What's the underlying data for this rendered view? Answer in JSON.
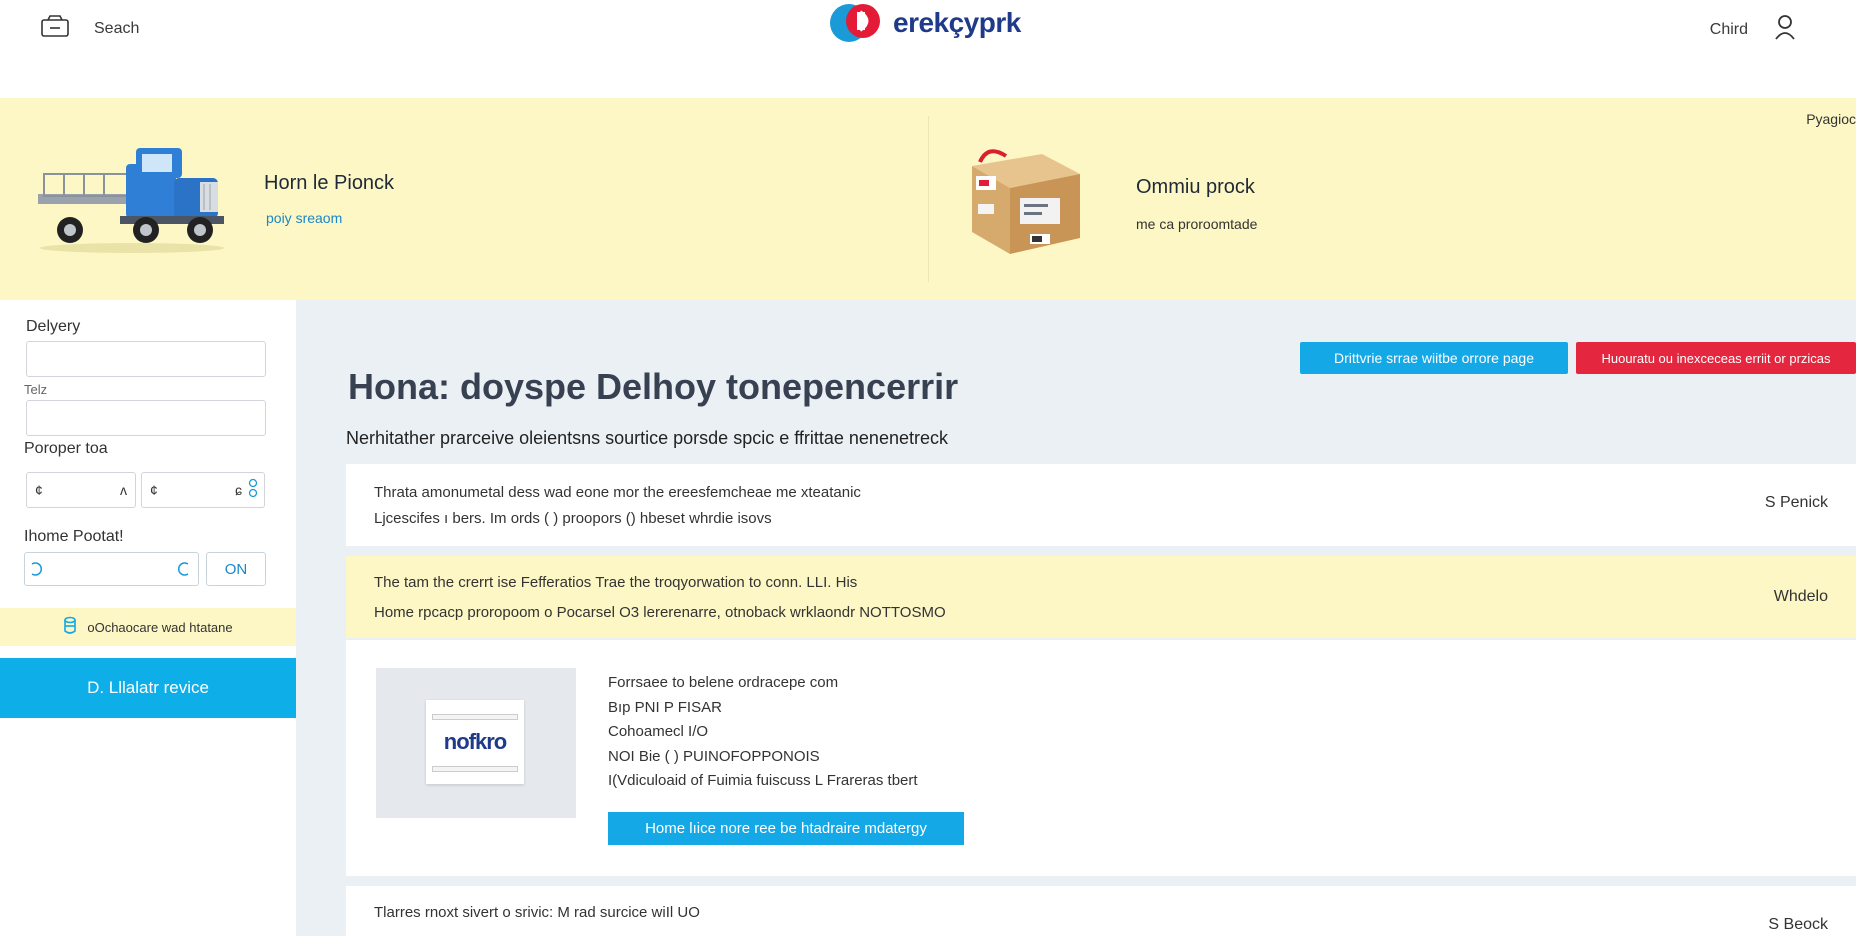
{
  "header": {
    "search_label": "Seach",
    "logo_text": "erekçyprk",
    "child_label": "Chird"
  },
  "hero": {
    "corner_label": "Pyagioc",
    "left": {
      "title": "Horn le Pionck",
      "link": "poiy sreaom"
    },
    "right": {
      "title": "Ommiu prock",
      "subtitle": "me ca proroomtade"
    }
  },
  "sidebar": {
    "delivery_label": "Delyery",
    "delivery_value": "",
    "tel_label": "Telz",
    "tel_value": "",
    "property_label": "Poroper toa",
    "property_from": "¢",
    "property_from_suffix": "ʌ",
    "property_to": "¢",
    "property_to_suffix": "ɕ",
    "postal_label": "Ihome Pootat!",
    "postal_value": "",
    "on_button": "ON",
    "note": "oOchaocare wad htatane",
    "cta": "D. Lllalatr revice"
  },
  "main": {
    "btn_blue": "Drittvrie srrae wiitbe orrore page",
    "btn_red": "Huouratu ou inexceceas erriit or przicas",
    "title": "Hona: doyspe Delhoy tonepencerrir",
    "subtitle": "Nerhitather prarceive oleientsns sourtice porsde spcic e ffrittae nenenetreck",
    "cards": [
      {
        "line1": "Thrata amonumetal dess wad eone mor the ereesfemcheae me xteatanic",
        "line2": "Ljcescifes ı bers. Im ords ( ) proopors () hbeset whrdie isovs",
        "right": "S Penick"
      },
      {
        "line1": "The tam the crerrt ise Fefferatios Trae the troqyorwation to conn. LLI. His",
        "line2": "Home rpcacp proropoom o Pocarsel O3 lererenarre, otnoback wrklaondr NOTTOSMO",
        "right": "Whdelo"
      },
      {
        "thumb_logo": "nofkro",
        "details": [
          "Forrsaee to belene ordracepe com",
          "Bıp PNI P FISAR",
          "Cohoamecl I/O",
          "NOI Bie ( ) PUINOFOPPONOIS",
          "I(Vdiculoaid of Fuimia fuiscuss L Frareras tbert"
        ],
        "button": "Home lıice nore ree be htadraire mdatergy"
      },
      {
        "line1": "Tlarres rnoxt sivert o srivic: M rad surcice wiIl UO",
        "right": "S Beock"
      }
    ]
  }
}
